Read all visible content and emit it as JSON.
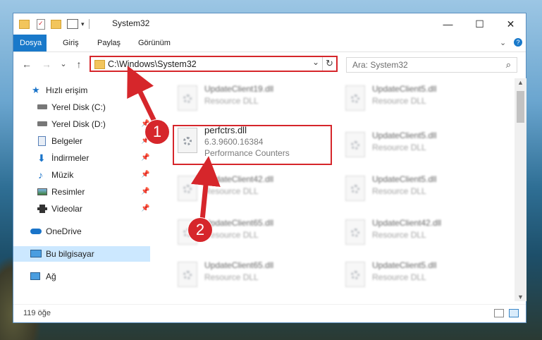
{
  "window": {
    "title": "System32",
    "controls": {
      "minimize": "—",
      "maximize": "☐",
      "close": "✕"
    }
  },
  "ribbon": {
    "tabs": [
      "Dosya",
      "Giriş",
      "Paylaş",
      "Görünüm"
    ],
    "expand_icon": "chevron-down-icon",
    "help_icon": "help-icon"
  },
  "nav": {
    "back": "←",
    "forward": "→",
    "recent": "⌄",
    "up": "↑",
    "address": "C:\\Windows\\System32",
    "address_dropdown": "⌄",
    "refresh": "↻",
    "search_placeholder": "Ara: System32"
  },
  "sidebar": {
    "items": [
      {
        "label": "Hızlı erişim",
        "icon": "star-icon",
        "pinned": false
      },
      {
        "label": "Yerel Disk (C:)",
        "icon": "drive-icon",
        "pinned": false
      },
      {
        "label": "Yerel Disk (D:)",
        "icon": "drive-icon",
        "pinned": true
      },
      {
        "label": "Belgeler",
        "icon": "documents-icon",
        "pinned": true
      },
      {
        "label": "İndirmeler",
        "icon": "download-icon",
        "pinned": true
      },
      {
        "label": "Müzik",
        "icon": "music-icon",
        "pinned": true
      },
      {
        "label": "Resimler",
        "icon": "pictures-icon",
        "pinned": true
      },
      {
        "label": "Videolar",
        "icon": "videos-icon",
        "pinned": true
      },
      {
        "label": "OneDrive",
        "icon": "cloud-icon",
        "pinned": false
      },
      {
        "label": "Bu bilgisayar",
        "icon": "computer-icon",
        "pinned": false,
        "selected": true
      },
      {
        "label": "Ağ",
        "icon": "network-icon",
        "pinned": false
      }
    ]
  },
  "files": {
    "left": [
      {
        "name": "UpdateClient19.dll",
        "type": "Resource DLL",
        "blurred": true
      },
      {
        "name": "perfctrs.dll",
        "version": "6.3.9600.16384",
        "type": "Performance Counters",
        "blurred": false
      },
      {
        "name": "UpdateClient42.dll",
        "type": "Resource DLL",
        "blurred": true
      },
      {
        "name": "UpdateClient65.dll",
        "type": "Resource DLL",
        "blurred": true
      },
      {
        "name": "UpdateClient65.dll",
        "type": "Resource DLL",
        "blurred": true
      }
    ],
    "right": [
      {
        "name": "UpdateClient5.dll",
        "type": "Resource DLL"
      },
      {
        "name": "UpdateClient5.dll",
        "type": "Resource DLL"
      },
      {
        "name": "UpdateClient5.dll",
        "type": "Resource DLL"
      },
      {
        "name": "UpdateClient42.dll",
        "type": "Resource DLL"
      },
      {
        "name": "UpdateClient5.dll",
        "type": "Resource DLL"
      }
    ]
  },
  "status": {
    "count": "119 öğe"
  },
  "annotations": {
    "callout1": "1",
    "callout2": "2"
  },
  "colors": {
    "accent": "#1979ca",
    "highlight": "#d6262b",
    "selection": "#cce8ff"
  }
}
